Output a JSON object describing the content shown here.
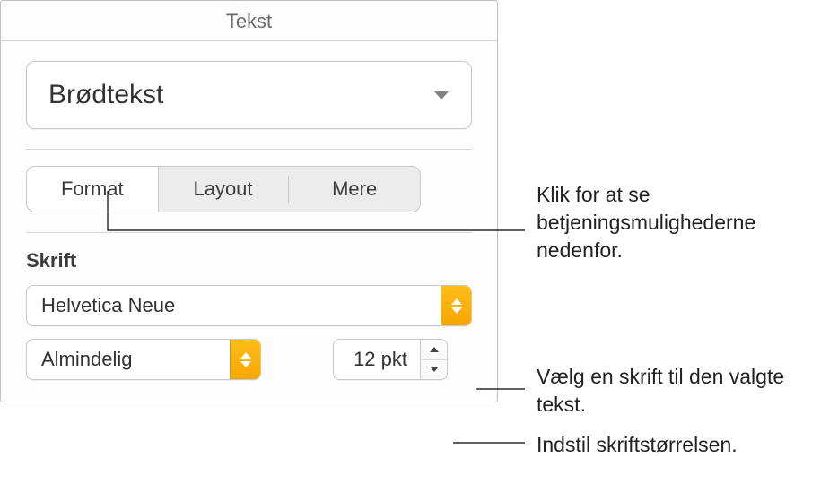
{
  "panel": {
    "title": "Tekst",
    "style_selected": "Brødtekst",
    "tabs": {
      "format": "Format",
      "layout": "Layout",
      "more": "Mere"
    },
    "font_section_label": "Skrift",
    "font_family": "Helvetica Neue",
    "typeface": "Almindelig",
    "size": "12 pkt"
  },
  "callouts": {
    "tabs": "Klik for at se betjeningsmulighederne nedenfor.",
    "font": "Vælg en skrift til den valgte tekst.",
    "size": "Indstil skriftstørrelsen."
  }
}
